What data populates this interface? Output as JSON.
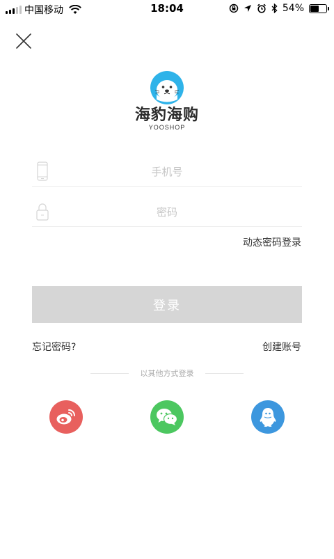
{
  "status_bar": {
    "carrier": "中国移动",
    "time": "18:04",
    "battery_text": "54%",
    "battery_level": 0.54
  },
  "icons": {
    "close": "close-icon",
    "phone": "phone-icon",
    "lock": "lock-icon",
    "weibo": "weibo-icon",
    "wechat": "wechat-icon",
    "qq": "qq-icon"
  },
  "brand": {
    "title": "海豹海购",
    "subtitle": "YOOSHOP",
    "accent": "#2fb3e9"
  },
  "form": {
    "phone_placeholder": "手机号",
    "password_placeholder": "密码",
    "dynamic_login": "动态密码登录",
    "login_label": "登录",
    "forgot_password": "忘记密码?",
    "create_account": "创建账号"
  },
  "other_login": {
    "label": "以其他方式登录",
    "colors": {
      "weibo": "#e8605e",
      "wechat": "#4cc760",
      "qq": "#3d97de"
    }
  }
}
